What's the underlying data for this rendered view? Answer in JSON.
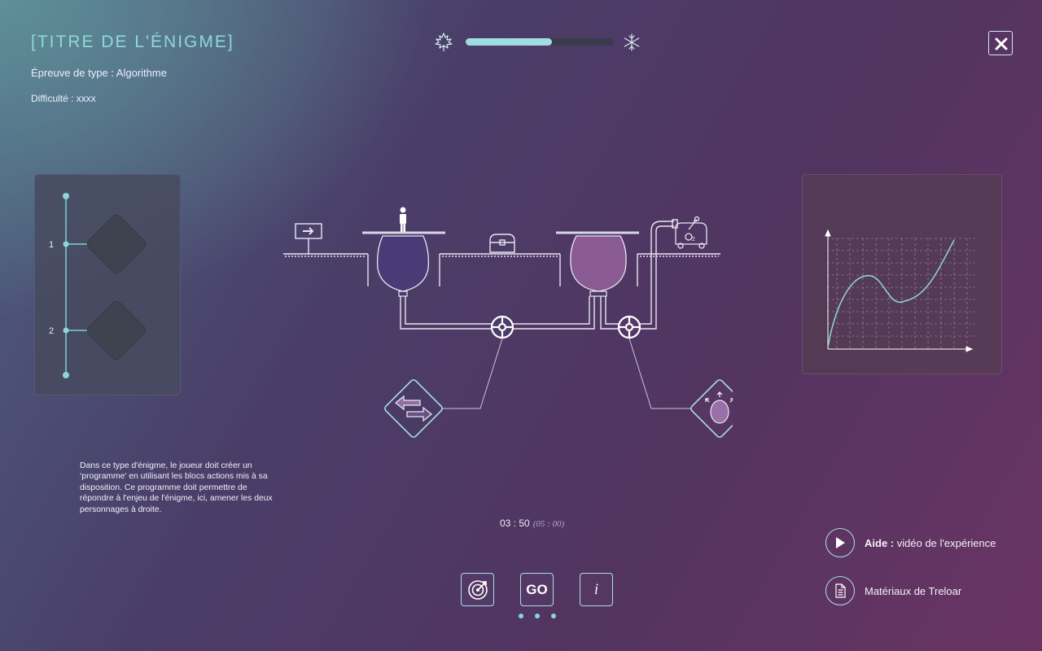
{
  "header": {
    "title": "[TITRE DE L'ÉNIGME]",
    "subtitle": "Épreuve de type : Algorithme",
    "difficulty": "Difficulté : xxxx"
  },
  "progress": {
    "value": 0.58,
    "left_icon": "maple-leaf-icon",
    "right_icon": "snowflake-icon"
  },
  "program": {
    "steps": [
      {
        "number": "1"
      },
      {
        "number": "2"
      }
    ]
  },
  "scene": {
    "action_badge_count": "2"
  },
  "description": "Dans ce type d'énigme, le joueur doit créer un ‘programme’ en utilisant les blocs actions mis à sa disposition. Ce programme doit permettre de répondre à l'enjeu de l'énigme, ici, amener les deux personnages à droite.",
  "timer": {
    "current": "03 : 50",
    "max": "(05 : 00)"
  },
  "help": {
    "bold": "Aide :",
    "text": "vidéo de l'expérience"
  },
  "materials": {
    "text": "Matériaux de Treloar"
  },
  "controls": {
    "go_label": "GO",
    "info_label": "i"
  },
  "colors": {
    "accent": "#9fdde2",
    "balloon_left": "#4a3a75",
    "balloon_right": "#8a5a92",
    "curve": "#8fd8d8"
  }
}
